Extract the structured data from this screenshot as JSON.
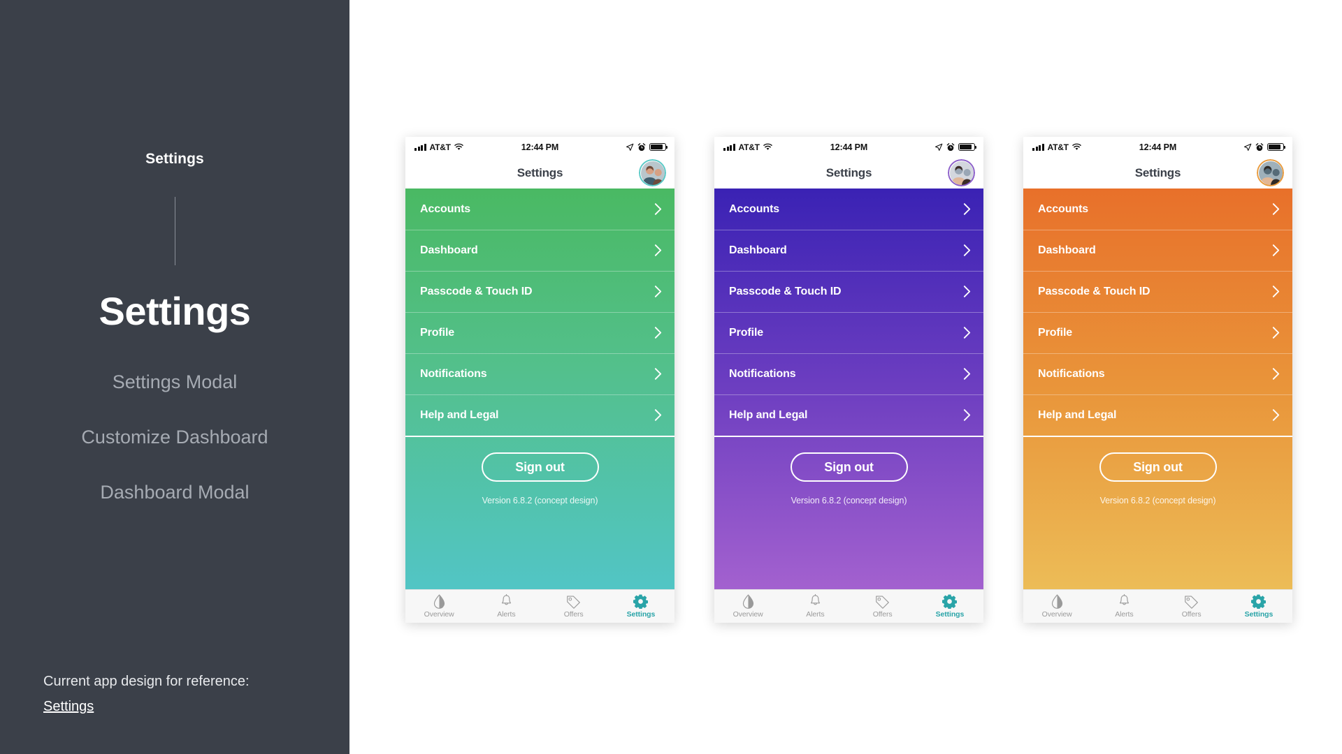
{
  "sidebar": {
    "small_title": "Settings",
    "big_title": "Settings",
    "nav_items": [
      {
        "label": "Settings Modal"
      },
      {
        "label": "Customize Dashboard"
      },
      {
        "label": "Dashboard Modal"
      }
    ],
    "footer": {
      "note": "Current app design for reference:",
      "link": "Settings"
    },
    "bg_color": "#3b4049",
    "muted_color": "#a6abb3"
  },
  "phones": [
    {
      "id": "green",
      "theme_name": "green-teal",
      "gradient_from": "#4ab963",
      "gradient_to": "#52c5c5",
      "avatar_ring": "#59c9c6",
      "statusbar": {
        "carrier": "AT&T",
        "time": "12:44 PM"
      },
      "navbar": {
        "title": "Settings"
      },
      "menu_items": [
        {
          "label": "Accounts"
        },
        {
          "label": "Dashboard"
        },
        {
          "label": "Passcode & Touch ID"
        },
        {
          "label": "Profile"
        },
        {
          "label": "Notifications"
        },
        {
          "label": "Help and Legal"
        }
      ],
      "signout_label": "Sign out",
      "version": "Version 6.8.2 (concept design)",
      "tabs": [
        {
          "label": "Overview",
          "icon": "droplet-icon",
          "active": false
        },
        {
          "label": "Alerts",
          "icon": "bell-icon",
          "active": false
        },
        {
          "label": "Offers",
          "icon": "tag-icon",
          "active": false
        },
        {
          "label": "Settings",
          "icon": "gear-icon",
          "active": true
        }
      ]
    },
    {
      "id": "purple",
      "theme_name": "indigo-violet",
      "gradient_from": "#3a22b4",
      "gradient_to": "#a361cf",
      "avatar_ring": "#8b5ec9",
      "statusbar": {
        "carrier": "AT&T",
        "time": "12:44 PM"
      },
      "navbar": {
        "title": "Settings"
      },
      "menu_items": [
        {
          "label": "Accounts"
        },
        {
          "label": "Dashboard"
        },
        {
          "label": "Passcode & Touch ID"
        },
        {
          "label": "Profile"
        },
        {
          "label": "Notifications"
        },
        {
          "label": "Help and Legal"
        }
      ],
      "signout_label": "Sign out",
      "version": "Version 6.8.2 (concept design)",
      "tabs": [
        {
          "label": "Overview",
          "icon": "droplet-icon",
          "active": false
        },
        {
          "label": "Alerts",
          "icon": "bell-icon",
          "active": false
        },
        {
          "label": "Offers",
          "icon": "tag-icon",
          "active": false
        },
        {
          "label": "Settings",
          "icon": "gear-icon",
          "active": true
        }
      ]
    },
    {
      "id": "orange",
      "theme_name": "orange-gold",
      "gradient_from": "#e8702a",
      "gradient_to": "#ecbc57",
      "avatar_ring": "#e99a3c",
      "statusbar": {
        "carrier": "AT&T",
        "time": "12:44 PM"
      },
      "navbar": {
        "title": "Settings"
      },
      "menu_items": [
        {
          "label": "Accounts"
        },
        {
          "label": "Dashboard"
        },
        {
          "label": "Passcode & Touch ID"
        },
        {
          "label": "Profile"
        },
        {
          "label": "Notifications"
        },
        {
          "label": "Help and Legal"
        }
      ],
      "signout_label": "Sign out",
      "version": "Version 6.8.2 (concept design)",
      "tabs": [
        {
          "label": "Overview",
          "icon": "droplet-icon",
          "active": false
        },
        {
          "label": "Alerts",
          "icon": "bell-icon",
          "active": false
        },
        {
          "label": "Offers",
          "icon": "tag-icon",
          "active": false
        },
        {
          "label": "Settings",
          "icon": "gear-icon",
          "active": true
        }
      ]
    }
  ]
}
